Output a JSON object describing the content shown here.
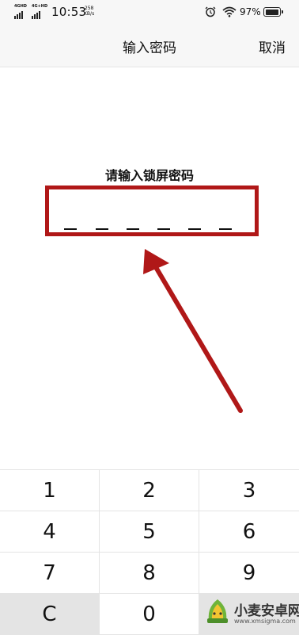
{
  "status_bar": {
    "signal_1": "4GHD",
    "signal_2": "4G+HD",
    "time": "10:53",
    "speed_value": "258",
    "speed_unit": "KB/s",
    "battery_percent": "97%",
    "icons": [
      "alarm-icon",
      "wifi-icon",
      "battery-icon"
    ]
  },
  "header": {
    "title": "输入密码",
    "cancel_label": "取消"
  },
  "prompt": {
    "label": "请输入锁屏密码",
    "pin_length": 6
  },
  "keypad": {
    "keys": [
      "1",
      "2",
      "3",
      "4",
      "5",
      "6",
      "7",
      "8",
      "9",
      "C",
      "0",
      ""
    ]
  },
  "annotation": {
    "arrow_color": "#b01818",
    "box_color": "#b01818"
  },
  "watermark": {
    "text": "小麦安卓网",
    "url": "www.xmsigma.com"
  }
}
